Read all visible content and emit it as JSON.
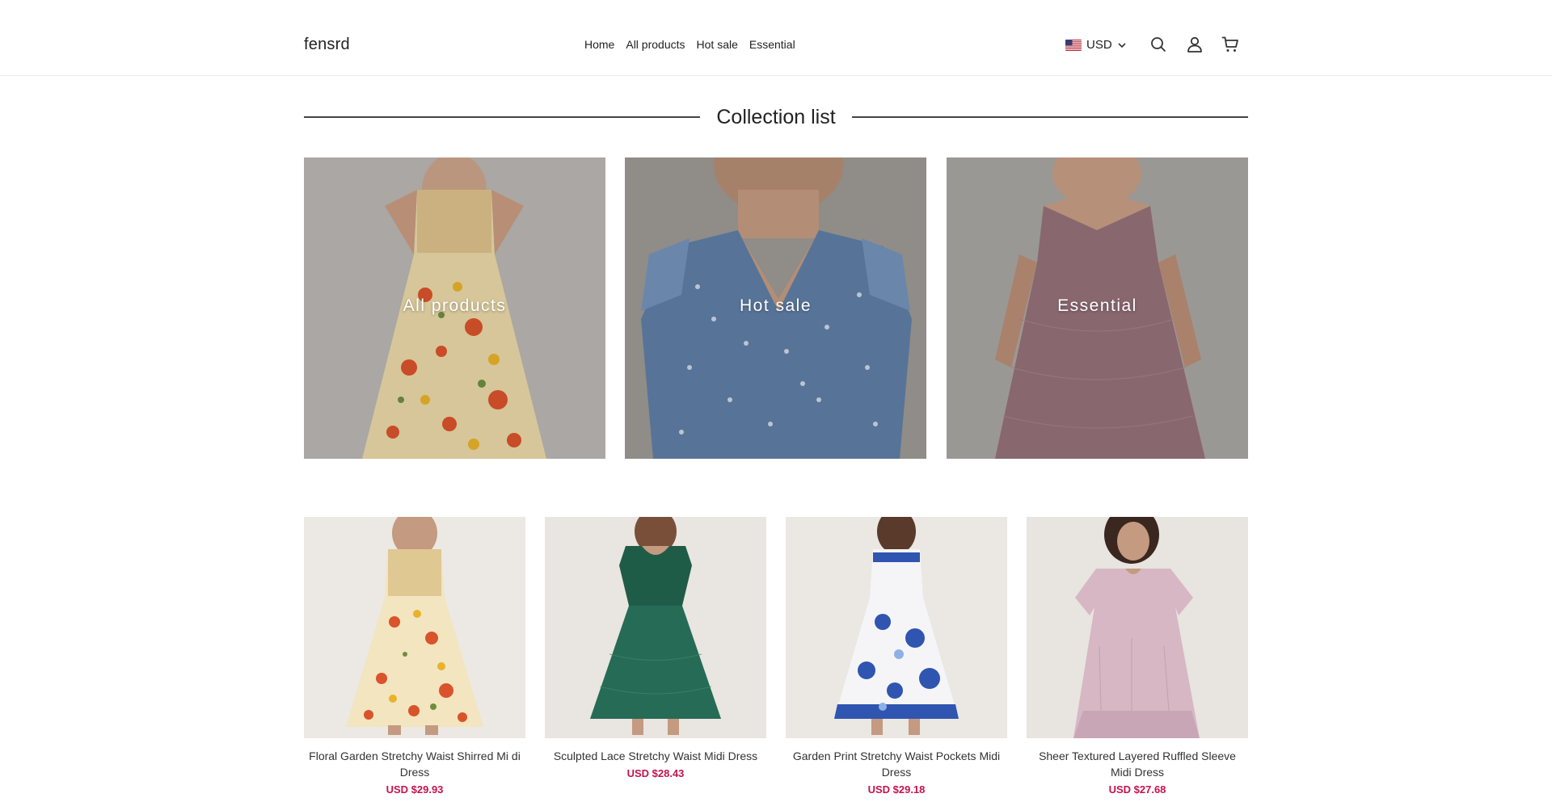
{
  "header": {
    "logo": "fensrd",
    "nav": [
      "Home",
      "All products",
      "Hot sale",
      "Essential"
    ],
    "currency": "USD",
    "icons": [
      "search-icon",
      "account-icon",
      "cart-icon"
    ]
  },
  "section": {
    "title": "Collection list"
  },
  "collections": [
    {
      "label": "All products",
      "image": "floral-smocked-dress"
    },
    {
      "label": "Hot sale",
      "image": "blue-floral-ruffle-dress"
    },
    {
      "label": "Essential",
      "image": "mauve-lace-dress"
    }
  ],
  "products": [
    {
      "name": "Floral Garden Stretchy Waist Shirred Mi di Dress",
      "price": "USD $29.93"
    },
    {
      "name": "Sculpted Lace Stretchy Waist Midi Dress",
      "price": "USD $28.43"
    },
    {
      "name": "Garden Print Stretchy Waist Pockets Midi Dress",
      "price": "USD $29.18"
    },
    {
      "name": "Sheer Textured Layered Ruffled Sleeve Midi Dress",
      "price": "USD $27.68"
    }
  ],
  "colors": {
    "price": "#c4134d",
    "divider": "#444444"
  }
}
